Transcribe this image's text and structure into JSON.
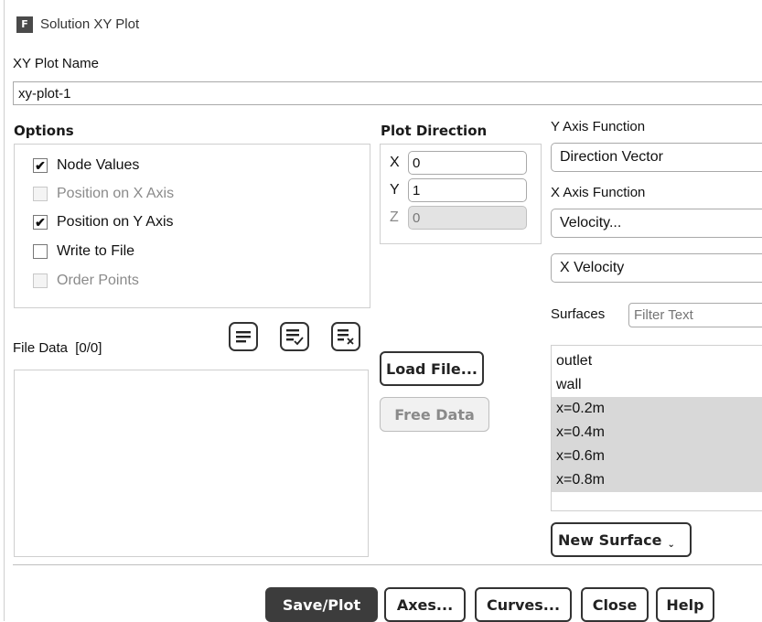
{
  "window": {
    "icon_letter": "F",
    "title": "Solution XY Plot"
  },
  "plot_name": {
    "label": "XY Plot Name",
    "value": "xy-plot-1"
  },
  "options": {
    "heading": "Options",
    "items": [
      {
        "label": "Node Values",
        "checked": true,
        "enabled": true
      },
      {
        "label": "Position on X Axis",
        "checked": false,
        "enabled": false
      },
      {
        "label": "Position on Y Axis",
        "checked": true,
        "enabled": true
      },
      {
        "label": "Write to File",
        "checked": false,
        "enabled": true
      },
      {
        "label": "Order Points",
        "checked": false,
        "enabled": false
      }
    ]
  },
  "plot_direction": {
    "heading": "Plot Direction",
    "x": {
      "letter": "X",
      "value": "0"
    },
    "y": {
      "letter": "Y",
      "value": "1"
    },
    "z": {
      "letter": "Z",
      "value": "0"
    }
  },
  "y_axis": {
    "label": "Y Axis Function",
    "value": "Direction Vector"
  },
  "x_axis": {
    "label": "X Axis Function",
    "category": "Velocity...",
    "value": "X Velocity"
  },
  "surfaces": {
    "label": "Surfaces",
    "filter_placeholder": "Filter Text",
    "items": [
      {
        "label": "outlet",
        "selected": false
      },
      {
        "label": "wall",
        "selected": false
      },
      {
        "label": "x=0.2m",
        "selected": true
      },
      {
        "label": "x=0.4m",
        "selected": true
      },
      {
        "label": "x=0.6m",
        "selected": true
      },
      {
        "label": "x=0.8m",
        "selected": true
      }
    ],
    "new_surface_label": "New Surface"
  },
  "file_data": {
    "label": "File Data",
    "count": "[0/0]"
  },
  "buttons": {
    "load_file": "Load File...",
    "free_data": "Free Data",
    "save_plot": "Save/Plot",
    "axes": "Axes...",
    "curves": "Curves...",
    "close": "Close",
    "help": "Help"
  },
  "icons": {
    "select_all": "select-all-icon",
    "deselect_all": "deselect-all-icon",
    "clear": "clear-icon"
  }
}
